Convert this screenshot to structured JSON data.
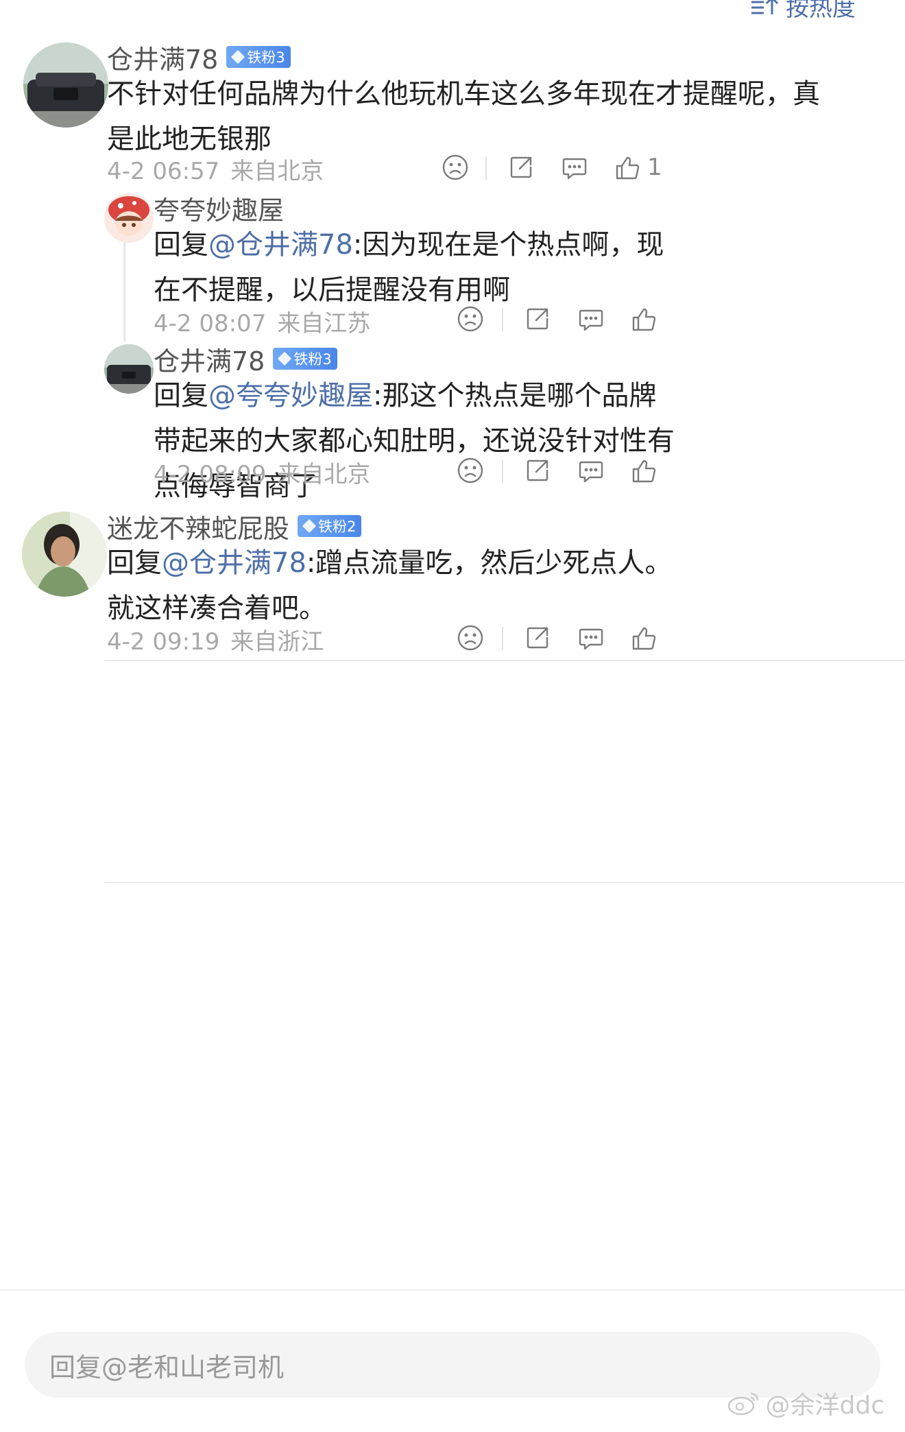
{
  "sort": {
    "label": "按热度",
    "icon": "sort-icon"
  },
  "comments": [
    {
      "name": "仓井满78",
      "badge": "铁粉3",
      "text": "不针对任何品牌为什么他玩机车这么多年现在才提醒呢，真是此地无银那",
      "time": "4-2 06:57",
      "location": "来自北京",
      "likes": "1",
      "replies": [
        {
          "name": "夸夸妙趣屋",
          "reply_prefix": "回复",
          "mention": "@仓井满78",
          "text": ":因为现在是个热点啊，现在不提醒，以后提醒没有用啊",
          "time": "4-2 08:07",
          "location": "来自江苏"
        },
        {
          "name": "仓井满78",
          "badge": "铁粉3",
          "reply_prefix": "回复",
          "mention": "@夸夸妙趣屋",
          "text": ":那这个热点是哪个品牌带起来的大家都心知肚明，还说没针对性有点侮辱智商了",
          "time": "4-2 08:09",
          "location": "来自北京"
        }
      ]
    },
    {
      "name": "迷龙不辣蛇屁股",
      "badge": "铁粉2",
      "reply_prefix": "回复",
      "mention": "@仓井满78",
      "text": ":蹭点流量吃，然后少死点人。就这样凑合着吧。",
      "time": "4-2 09:19",
      "location": "来自浙江"
    }
  ],
  "reply_input": {
    "placeholder": "回复@老和山老司机"
  },
  "watermark": "@余洋ddc",
  "colors": {
    "accent": "#4d6fa8",
    "badge": "#4a86e8",
    "meta": "#a8a8a8"
  }
}
